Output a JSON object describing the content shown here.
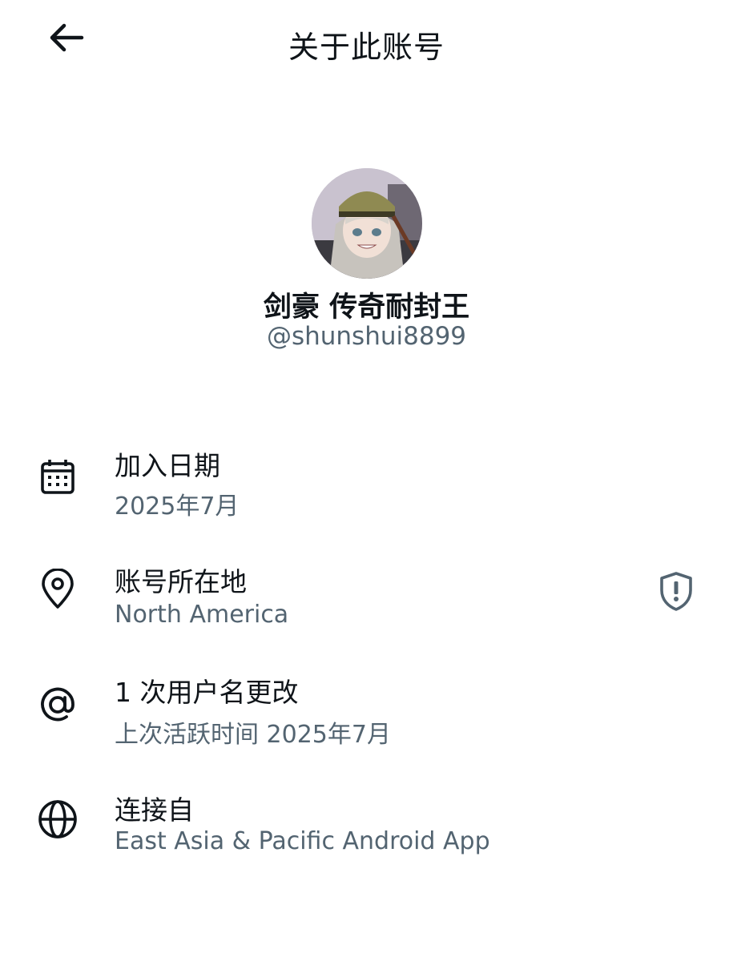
{
  "header": {
    "back_icon": "arrow-left-icon",
    "title": "关于此账号"
  },
  "profile": {
    "display_name": "剑豪 传奇耐封王",
    "handle": "@shunshui8899"
  },
  "rows": [
    {
      "icon": "calendar-icon",
      "label": "加入日期",
      "value": "2025年7月"
    },
    {
      "icon": "location-pin-icon",
      "label": "账号所在地",
      "value": "North America",
      "action_icon": "shield-alert-icon"
    },
    {
      "icon": "at-sign-icon",
      "label": "1 次用户名更改",
      "value": "上次活跃时间 2025年7月"
    },
    {
      "icon": "globe-icon",
      "label": "连接自",
      "value": "East Asia & Pacific Android App"
    }
  ],
  "colors": {
    "primary_text": "#0f1419",
    "secondary_text": "#536471",
    "background": "#ffffff"
  }
}
